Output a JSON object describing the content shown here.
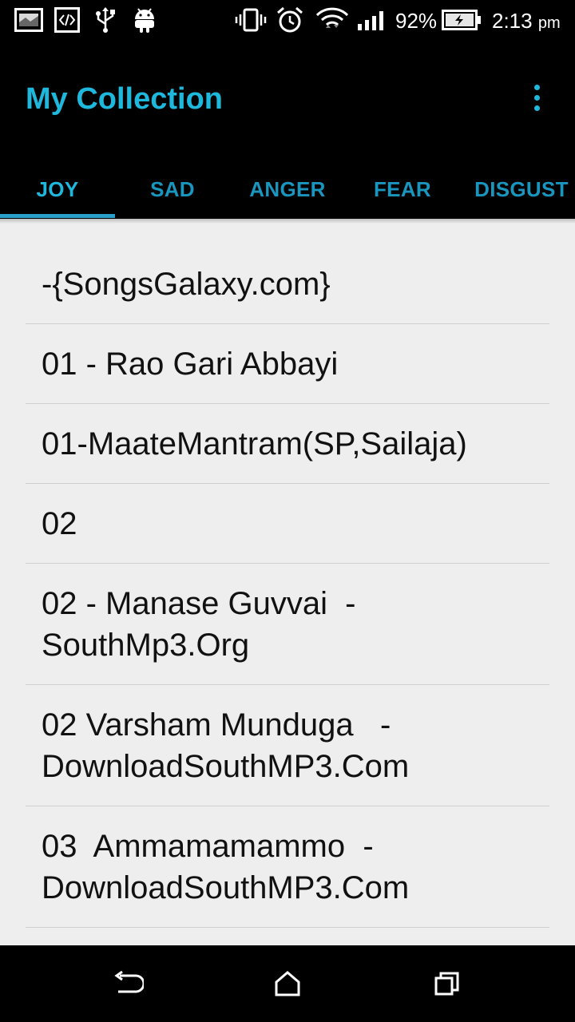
{
  "status_bar": {
    "battery_percent": "92%",
    "time": "2:13",
    "time_suffix": "pm",
    "icons": [
      "screenshot-icon",
      "developer-code-icon",
      "usb-icon",
      "android-icon",
      "vibrate-icon",
      "alarm-icon",
      "wifi-icon",
      "signal-icon",
      "battery-charging-icon"
    ]
  },
  "action_bar": {
    "title": "My Collection",
    "overflow_icon": "more-vert-icon"
  },
  "tabs": [
    {
      "label": "JOY",
      "active": true
    },
    {
      "label": "SAD",
      "active": false
    },
    {
      "label": "ANGER",
      "active": false
    },
    {
      "label": "FEAR",
      "active": false
    },
    {
      "label": "DISGUST",
      "active": false
    }
  ],
  "songs": [
    "-{SongsGalaxy.com}",
    "01 - Rao Gari Abbayi",
    "01-MaateMantram(SP,Sailaja)",
    "02",
    "02 - Manase Guvvai  -\nSouthMp3.Org",
    "02 Varsham Munduga   -\nDownloadSouthMP3.Com",
    "03  Ammamamammo  -\nDownloadSouthMP3.Com"
  ],
  "nav_bar": {
    "back_icon": "back-icon",
    "home_icon": "home-icon",
    "recents_icon": "recents-icon"
  },
  "colors": {
    "accent": "#1fb8dd",
    "tab_inactive": "#1a95be",
    "list_background": "#eeeeee",
    "divider": "#cfcfcf"
  }
}
